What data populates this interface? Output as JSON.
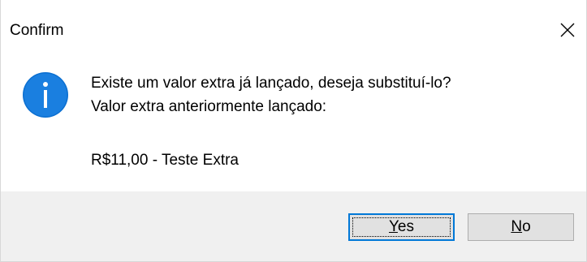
{
  "window": {
    "title": "Confirm",
    "close_icon": "close-icon"
  },
  "message": {
    "icon": "info-icon",
    "line1": "Existe um valor extra já lançado, deseja substituí-lo?",
    "line2": "Valor extra anteriormente lançado:",
    "line3": "R$11,00 - Teste Extra"
  },
  "buttons": {
    "yes": {
      "accel": "Y",
      "rest": "es"
    },
    "no": {
      "accel": "N",
      "rest": "o"
    }
  },
  "colors": {
    "icon_blue": "#0b6fd1",
    "footer_bg": "#f0f0f0",
    "button_bg": "#e1e1e1",
    "default_button_border": "#0078d7"
  }
}
